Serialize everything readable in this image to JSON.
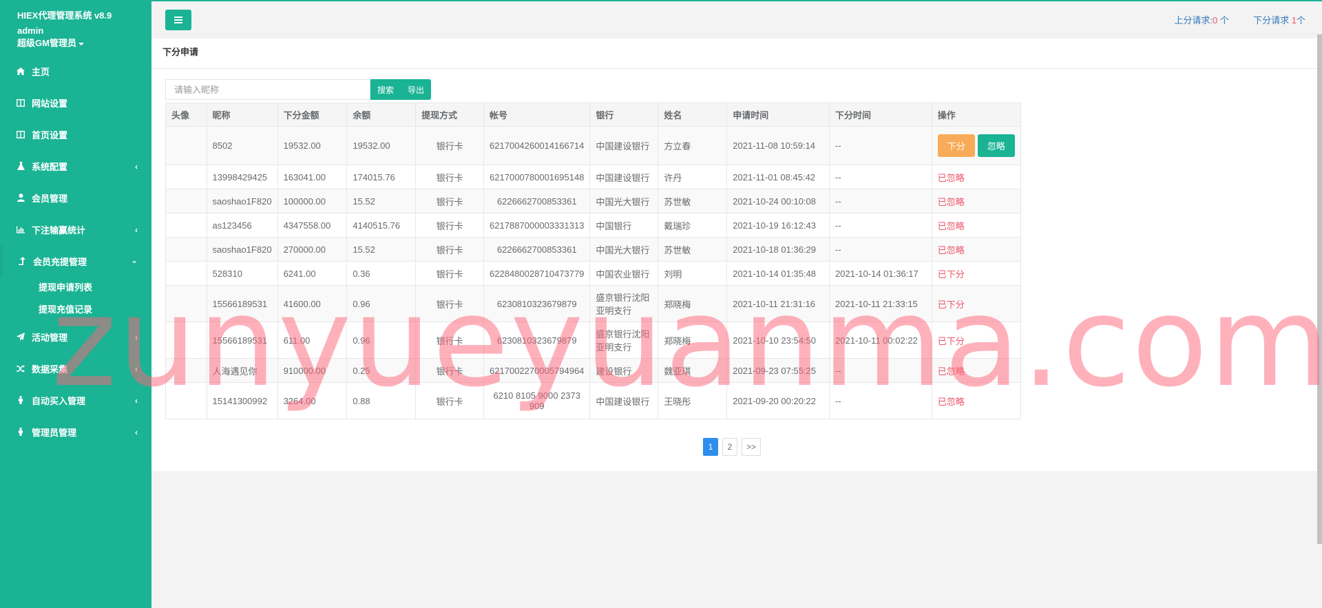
{
  "brand": {
    "title": "HIEX代理管理系统 v8.9",
    "user": "admin",
    "role": "超级GM管理员"
  },
  "nav": {
    "items": [
      {
        "label": "主页",
        "icon": "home-icon"
      },
      {
        "label": "网站设置",
        "icon": "columns-icon"
      },
      {
        "label": "首页设置",
        "icon": "columns-icon"
      },
      {
        "label": "系统配置",
        "icon": "flask-icon"
      },
      {
        "label": "会员管理",
        "icon": "user-icon"
      },
      {
        "label": "下注输赢统计",
        "icon": "bar-chart-icon"
      },
      {
        "label": "会员充提管理",
        "icon": "level-up-icon"
      },
      {
        "label": "活动管理",
        "icon": "paper-plane-icon"
      },
      {
        "label": "数据采集",
        "icon": "random-icon"
      },
      {
        "label": "自动买入管理",
        "icon": "male-icon"
      },
      {
        "label": "管理员管理",
        "icon": "male-icon"
      }
    ],
    "sub_items": [
      "提现申请列表",
      "提现充值记录"
    ]
  },
  "topbar": {
    "up_label": "上分请求:",
    "up_count": "0",
    "up_unit": " 个",
    "down_label": "下分请求 ",
    "down_count": "1",
    "down_unit": "个"
  },
  "page": {
    "title": "下分申请",
    "search_placeholder": "请输入昵称",
    "search_button": "搜索",
    "export_button": "导出"
  },
  "table": {
    "headers": [
      "头像",
      "昵称",
      "下分金额",
      "余额",
      "提现方式",
      "帐号",
      "银行",
      "姓名",
      "申请时间",
      "下分时间",
      "操作"
    ],
    "rows": [
      {
        "nick": "8502",
        "amount": "19532.00",
        "balance": "19532.00",
        "method": "银行卡",
        "account": "6217004260014166714",
        "bank": "中国建设银行",
        "name": "方立春",
        "apply": "2021-11-08 10:59:14",
        "done": "--",
        "status": ""
      },
      {
        "nick": "13998429425",
        "amount": "163041.00",
        "balance": "174015.76",
        "method": "银行卡",
        "account": "6217000780001695148",
        "bank": "中国建设银行",
        "name": "许丹",
        "apply": "2021-11-01 08:45:42",
        "done": "--",
        "status": "已忽略"
      },
      {
        "nick": "saoshao1F820",
        "amount": "100000.00",
        "balance": "15.52",
        "method": "银行卡",
        "account": "6226662700853361",
        "bank": "中国光大银行",
        "name": "苏世敏",
        "apply": "2021-10-24 00:10:08",
        "done": "--",
        "status": "已忽略"
      },
      {
        "nick": "as123456",
        "amount": "4347558.00",
        "balance": "4140515.76",
        "method": "银行卡",
        "account": "6217887000003331313",
        "bank": "中国银行",
        "name": "戴瑞珍",
        "apply": "2021-10-19 16:12:43",
        "done": "--",
        "status": "已忽略"
      },
      {
        "nick": "saoshao1F820",
        "amount": "270000.00",
        "balance": "15.52",
        "method": "银行卡",
        "account": "6226662700853361",
        "bank": "中国光大银行",
        "name": "苏世敏",
        "apply": "2021-10-18 01:36:29",
        "done": "--",
        "status": "已忽略"
      },
      {
        "nick": "528310",
        "amount": "6241.00",
        "balance": "0.36",
        "method": "银行卡",
        "account": "6228480028710473779",
        "bank": "中国农业银行",
        "name": "刘明",
        "apply": "2021-10-14 01:35:48",
        "done": "2021-10-14 01:36:17",
        "status": "已下分"
      },
      {
        "nick": "15566189531",
        "amount": "41600.00",
        "balance": "0.96",
        "method": "银行卡",
        "account": "6230810323679879",
        "bank": "盛京银行沈阳亚明支行",
        "name": "郑晓梅",
        "apply": "2021-10-11 21:31:16",
        "done": "2021-10-11 21:33:15",
        "status": "已下分"
      },
      {
        "nick": "15566189531",
        "amount": "611.00",
        "balance": "0.96",
        "method": "银行卡",
        "account": "6230810323679879",
        "bank": "盛京银行沈阳亚明支行",
        "name": "郑晓梅",
        "apply": "2021-10-10 23:54:50",
        "done": "2021-10-11 00:02:22",
        "status": "已下分"
      },
      {
        "nick": "人海遇见你",
        "amount": "910000.00",
        "balance": "0.25",
        "method": "银行卡",
        "account": "6217002270005794964",
        "bank": "建设银行",
        "name": "魏亚琪",
        "apply": "2021-09-23 07:55:25",
        "done": "--",
        "status": "已忽略"
      },
      {
        "nick": "15141300992",
        "amount": "3264.00",
        "balance": "0.88",
        "method": "银行卡",
        "account": "6210 8105 9000 2373 909",
        "bank": "中国建设银行",
        "name": "王晓彤",
        "apply": "2021-09-20 00:20:22",
        "done": "--",
        "status": "已忽略"
      }
    ],
    "action_down": "下分",
    "action_ignore": "忽略"
  },
  "pagination": {
    "pages": [
      "1",
      "2"
    ],
    "next": ">>"
  },
  "watermark": "zunyueyuanma.com",
  "colors": {
    "accent": "#1ab394",
    "warning": "#f8ac59",
    "danger": "#ed5565",
    "link": "#337ab7"
  }
}
